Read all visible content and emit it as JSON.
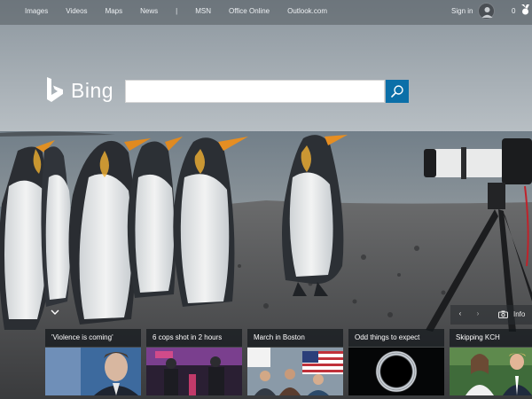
{
  "nav": {
    "links": [
      "Images",
      "Videos",
      "Maps",
      "News"
    ],
    "separator": "|",
    "right_links": [
      "MSN",
      "Office Online",
      "Outlook.com"
    ]
  },
  "account": {
    "signin_label": "Sign in",
    "rewards_count": "0"
  },
  "logo": {
    "text": "Bing"
  },
  "search": {
    "value": "",
    "placeholder": ""
  },
  "image_controls": {
    "prev": "‹",
    "next": "›",
    "info_label": "Info"
  },
  "news": [
    {
      "title": "'Violence is coming'"
    },
    {
      "title": "6 cops shot in 2 hours"
    },
    {
      "title": "March in Boston"
    },
    {
      "title": "Odd things to expect"
    },
    {
      "title": "Skipping KCH"
    }
  ],
  "colors": {
    "search_button": "#0b6fa8",
    "title_bar": "#14181c",
    "sky": "#7e8a94"
  }
}
